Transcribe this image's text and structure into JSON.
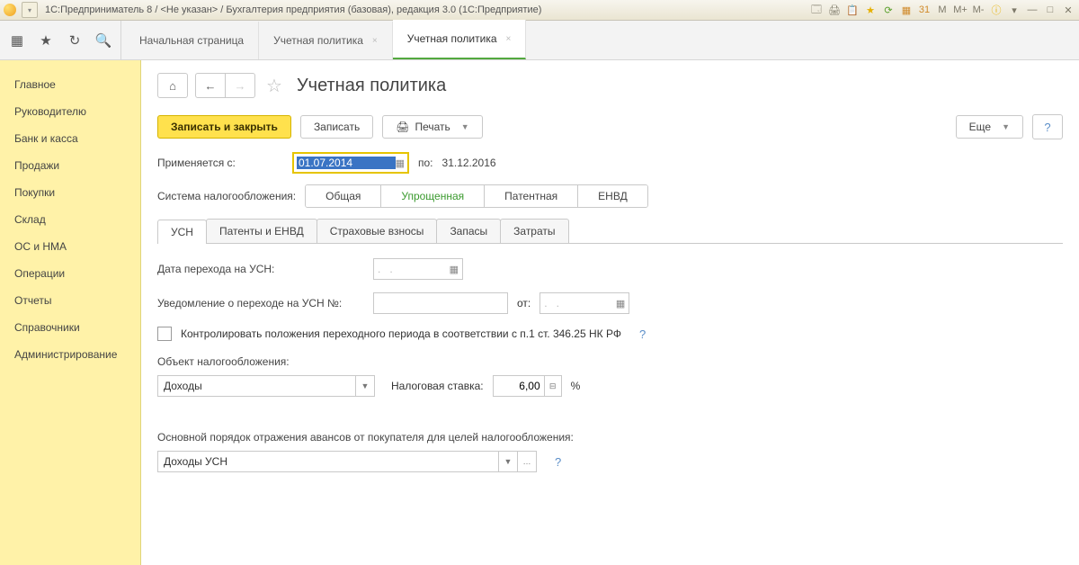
{
  "window_title": "1С:Предприниматель 8 / <Не указан> / Бухгалтерия предприятия (базовая), редакция 3.0  (1С:Предприятие)",
  "top_tabs": [
    {
      "label": "Начальная страница",
      "closable": false
    },
    {
      "label": "Учетная политика",
      "closable": true
    },
    {
      "label": "Учетная политика",
      "closable": true,
      "active": true
    }
  ],
  "sidebar": {
    "items": [
      {
        "label": "Главное"
      },
      {
        "label": "Руководителю"
      },
      {
        "label": "Банк и касса"
      },
      {
        "label": "Продажи"
      },
      {
        "label": "Покупки"
      },
      {
        "label": "Склад"
      },
      {
        "label": "ОС и НМА"
      },
      {
        "label": "Операции"
      },
      {
        "label": "Отчеты"
      },
      {
        "label": "Справочники"
      },
      {
        "label": "Администрирование"
      }
    ]
  },
  "page": {
    "title": "Учетная политика",
    "save_close": "Записать и закрыть",
    "save": "Записать",
    "print": "Печать",
    "more": "Еще",
    "applies_from_lbl": "Применяется с:",
    "date_from": "01.07.2014",
    "to_lbl": "по:",
    "date_to": "31.12.2016",
    "tax_system_lbl": "Система налогообложения:",
    "tax_segments": [
      "Общая",
      "Упрощенная",
      "Патентная",
      "ЕНВД"
    ],
    "tax_active": 1,
    "inner_tabs": [
      "УСН",
      "Патенты и ЕНВД",
      "Страховые взносы",
      "Запасы",
      "Затраты"
    ],
    "inner_active": 0,
    "usn_date_lbl": "Дата перехода на УСН:",
    "usn_notice_lbl": "Уведомление о переходе на УСН №:",
    "usn_notice_from": "от:",
    "control_chk": "Контролировать положения переходного периода в соответствии с п.1 ст. 346.25 НК РФ",
    "obj_lbl": "Объект налогообложения:",
    "obj_value": "Доходы",
    "rate_lbl": "Налоговая ставка:",
    "rate_value": "6,00",
    "rate_unit": "%",
    "advance_lbl": "Основной порядок отражения авансов от покупателя для целей налогообложения:",
    "advance_value": "Доходы УСН"
  }
}
